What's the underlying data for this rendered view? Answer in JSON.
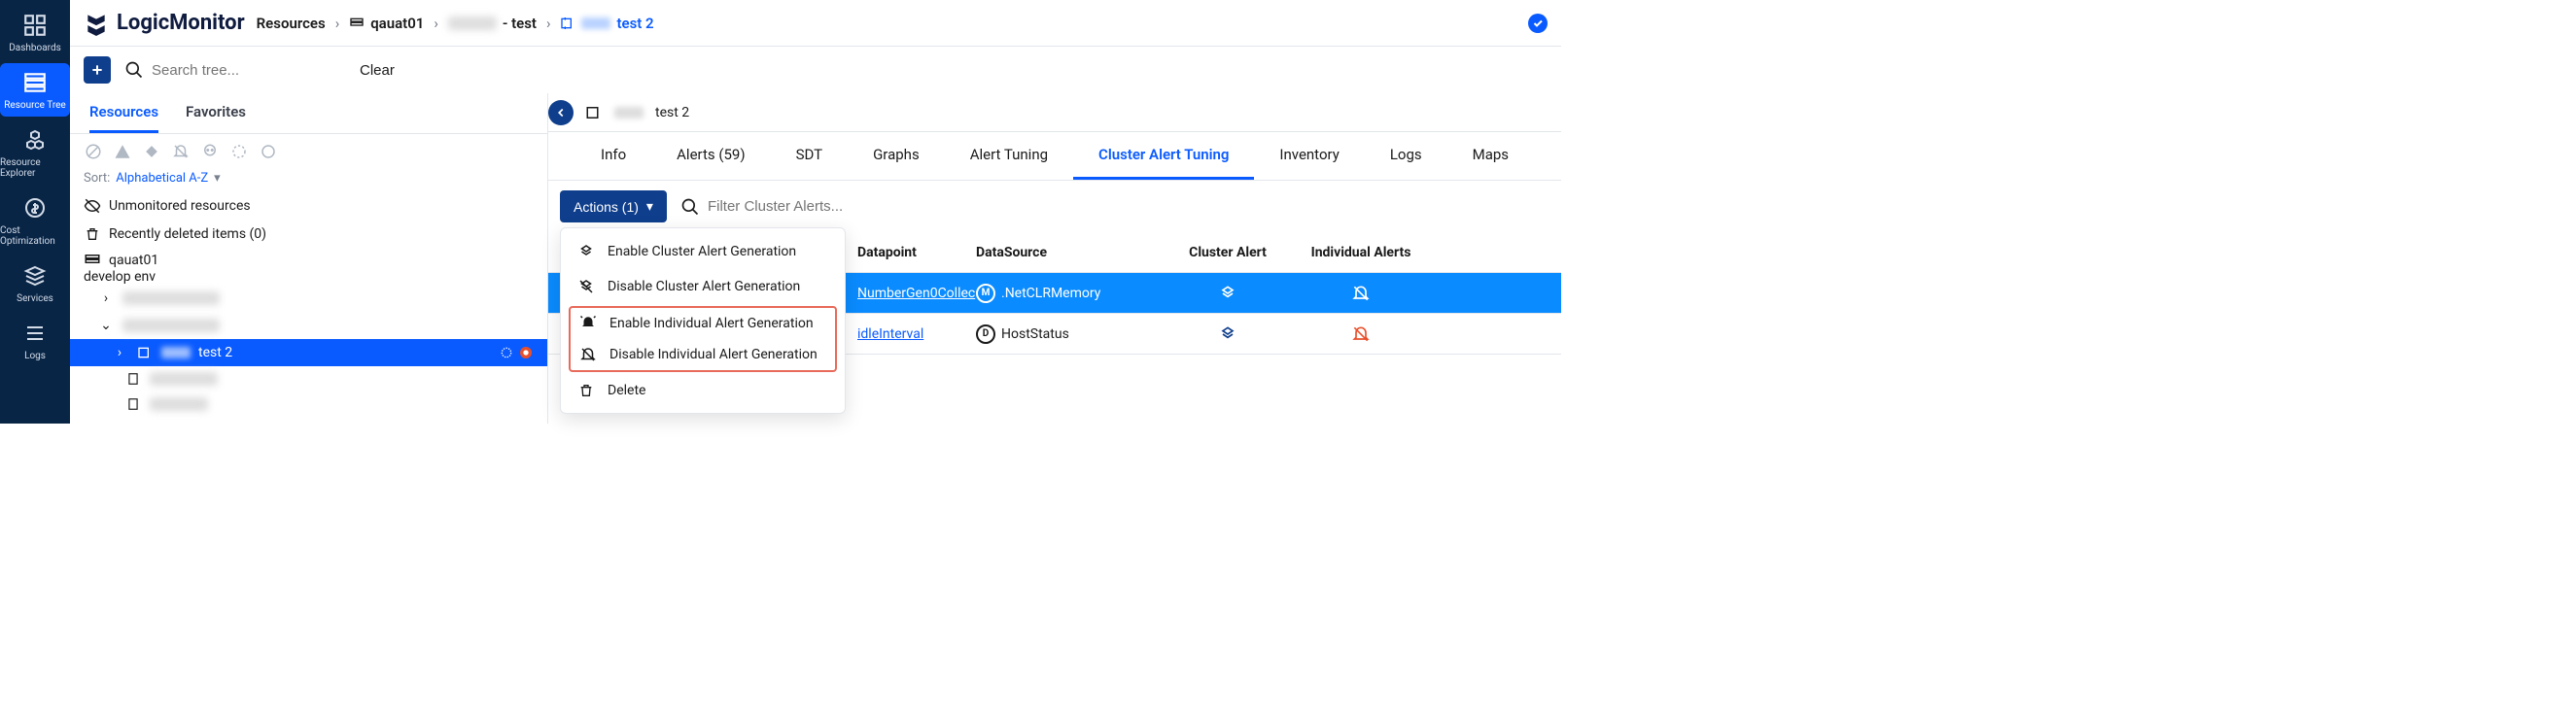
{
  "left_nav": {
    "items": [
      {
        "label": "Dashboards"
      },
      {
        "label": "Resource Tree"
      },
      {
        "label": "Resource Explorer"
      },
      {
        "label": "Cost Optimization"
      },
      {
        "label": "Services"
      },
      {
        "label": "Logs"
      }
    ]
  },
  "logo": {
    "text": "LogicMonitor"
  },
  "breadcrumb": {
    "root": "Resources",
    "items": [
      {
        "label": "qauat01"
      },
      {
        "label": "- test"
      },
      {
        "label": "test 2"
      }
    ]
  },
  "toolbar": {
    "search_placeholder": "Search tree...",
    "clear_label": "Clear"
  },
  "tree": {
    "tabs": {
      "resources": "Resources",
      "favorites": "Favorites"
    },
    "sort_label": "Sort:",
    "sort_value": "Alphabetical A-Z",
    "unmonitored": "Unmonitored resources",
    "recently_deleted": "Recently deleted items (0)",
    "root": {
      "name": "qauat01",
      "desc": "develop env"
    },
    "selected": {
      "name": "test 2"
    }
  },
  "content": {
    "header_title": "test 2",
    "tabs": [
      "Info",
      "Alerts (59)",
      "SDT",
      "Graphs",
      "Alert Tuning",
      "Cluster Alert Tuning",
      "Inventory",
      "Logs",
      "Maps"
    ],
    "active_tab": "Cluster Alert Tuning",
    "actions_label": "Actions (1)",
    "filter_placeholder": "Filter Cluster Alerts..."
  },
  "actions_menu": {
    "items": [
      "Enable Cluster Alert Generation",
      "Disable Cluster Alert Generation",
      "Enable Individual Alert Generation",
      "Disable Individual Alert Generation",
      "Delete"
    ]
  },
  "table": {
    "headers": {
      "dp": "Datapoint",
      "ds": "DataSource",
      "ca": "Cluster Alert",
      "ia": "Individual Alerts"
    },
    "rows": [
      {
        "dp": "NumberGen0Collec",
        "ds": ".NetCLRMemory",
        "dsletter": "M",
        "ia_warn": false
      },
      {
        "dp": "idleInterval",
        "ds": "HostStatus",
        "dsletter": "D",
        "ia_warn": true
      }
    ]
  }
}
